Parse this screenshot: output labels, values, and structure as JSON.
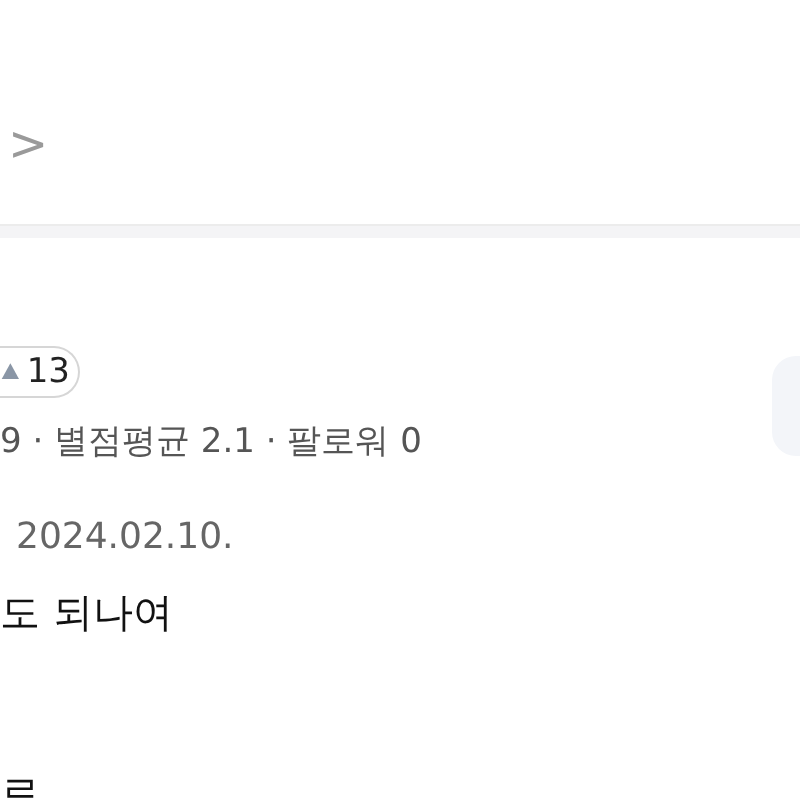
{
  "header": {
    "chevron": ">"
  },
  "reviewer": {
    "badge_count": "13",
    "meta": "9 · 별점평균 2.1 · 팔로워 0"
  },
  "review": {
    "date": "2024.02.10.",
    "text": "도 되나여",
    "next_line": "르"
  }
}
